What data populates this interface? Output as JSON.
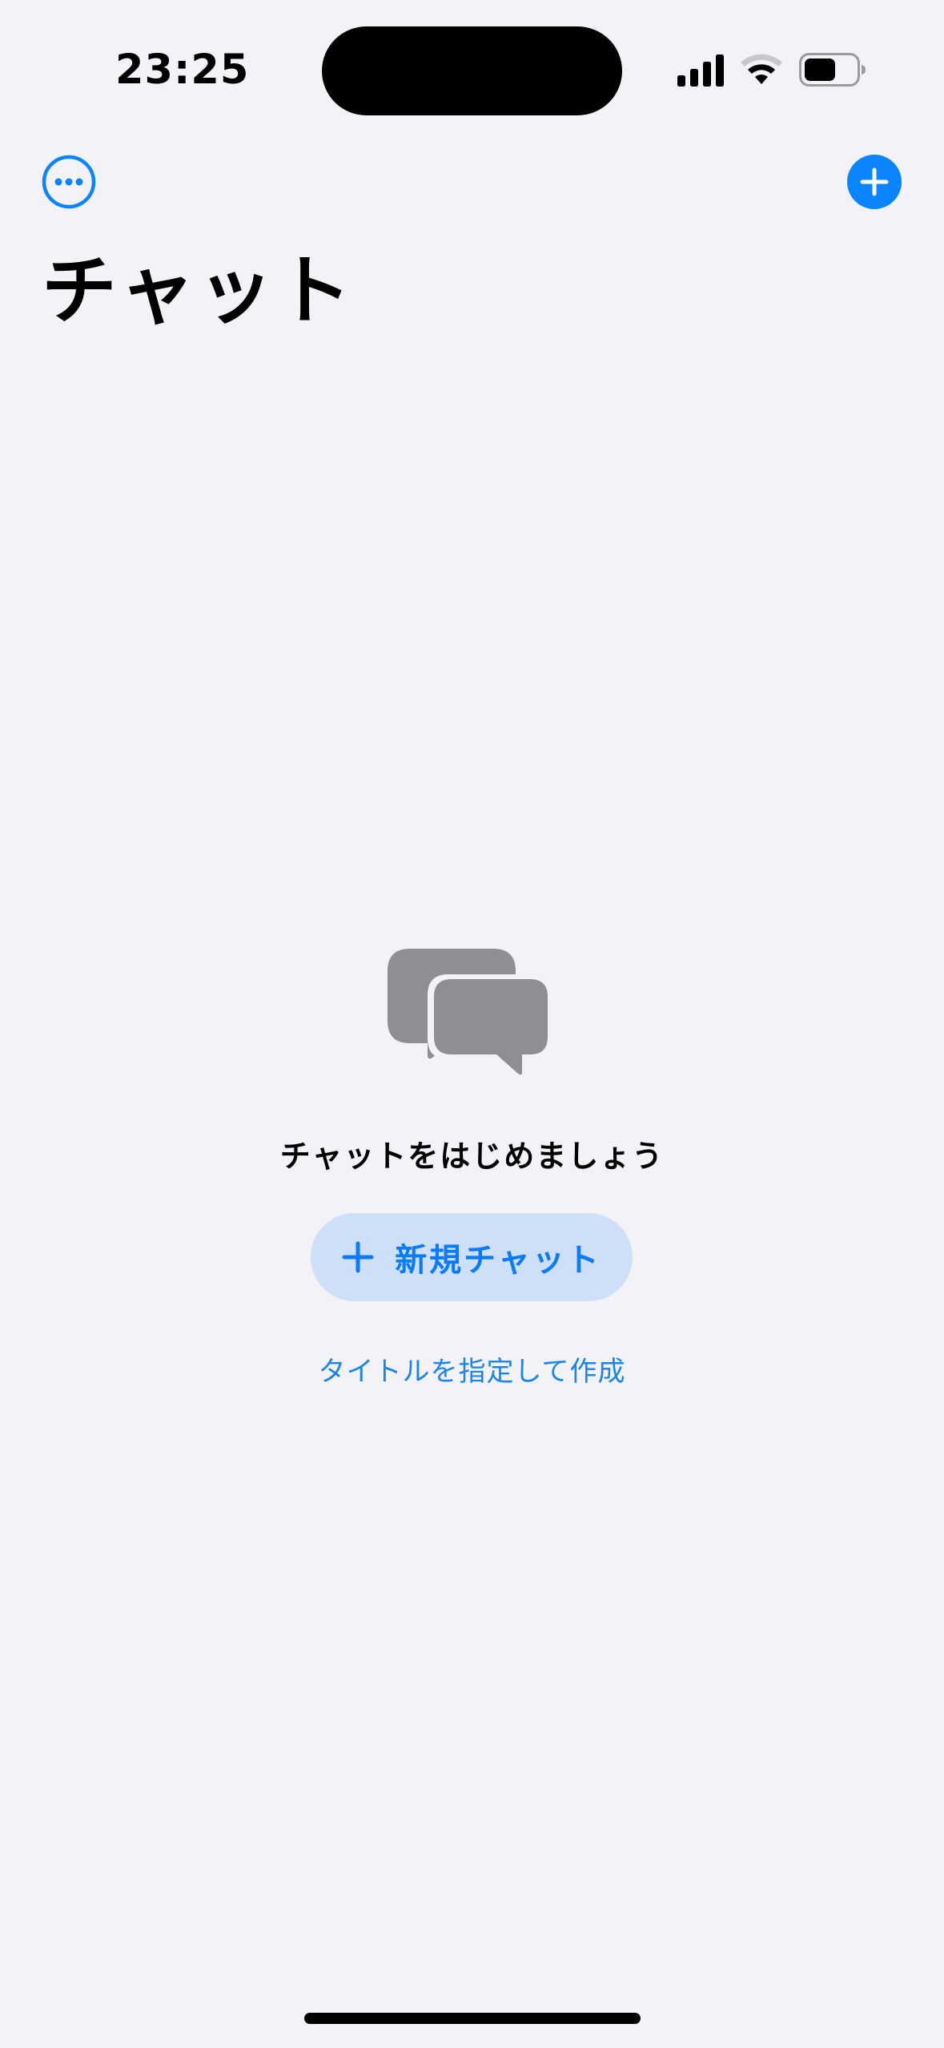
{
  "status_bar": {
    "time": "23:25"
  },
  "nav": {
    "more_icon": "ellipsis-circle-icon",
    "add_icon": "plus-circle-fill-icon",
    "accent": "#0A84FF"
  },
  "header": {
    "title": "チャット"
  },
  "empty_state": {
    "icon": "chat-bubbles-icon",
    "title": "チャットをはじめましょう",
    "new_chat_label": "新規チャット",
    "titled_link_label": "タイトルを指定して作成"
  },
  "colors": {
    "background": "#F2F2F7",
    "button_bg": "#CEE0F7",
    "icon_gray": "#8E8E93"
  }
}
